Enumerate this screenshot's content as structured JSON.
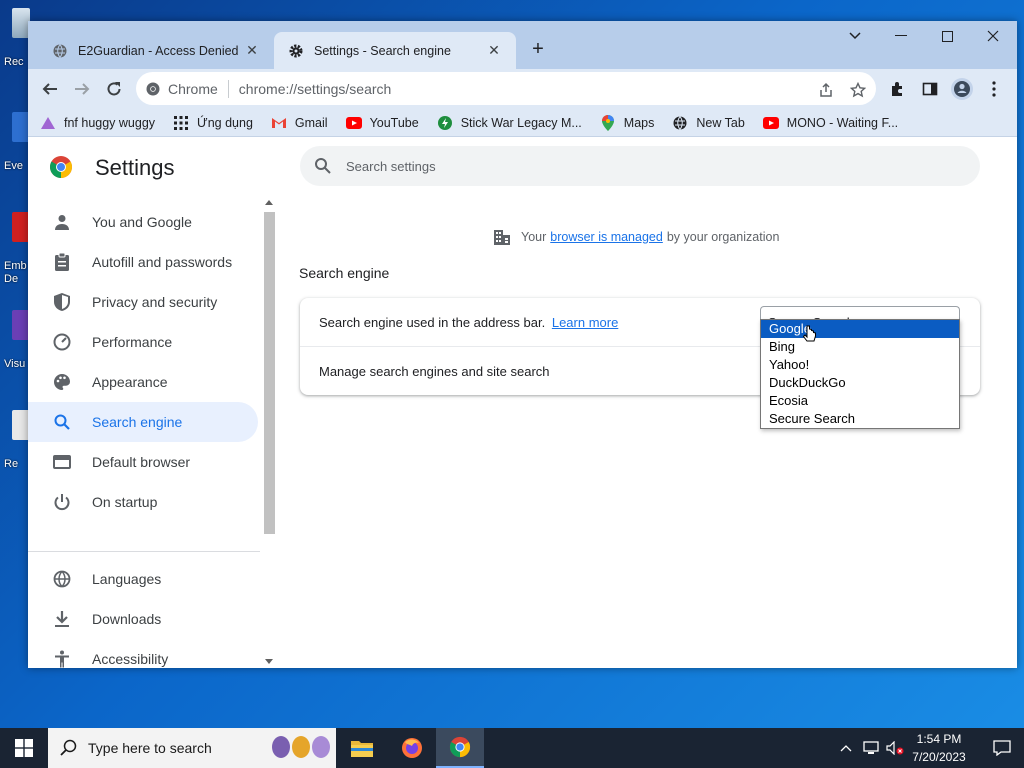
{
  "desktop": {
    "icons": [
      {
        "label": "Rec"
      },
      {
        "label": "Eve"
      },
      {
        "label": "Emb De"
      },
      {
        "label": "Visu"
      },
      {
        "label": "Re"
      }
    ]
  },
  "browser": {
    "tabs": [
      {
        "title": "E2Guardian - Access Denied",
        "active": false,
        "icon": "globe-icon"
      },
      {
        "title": "Settings - Search engine",
        "active": true,
        "icon": "gear-icon"
      }
    ],
    "omnibox": {
      "chip_label": "Chrome",
      "url": "chrome://settings/search"
    },
    "bookmarks": [
      {
        "label": "fnf huggy wuggy",
        "icon": "triangle-icon",
        "color": "#a066d3"
      },
      {
        "label": "Ứng dụng",
        "icon": "apps-grid-icon",
        "color": "#202124"
      },
      {
        "label": "Gmail",
        "icon": "gmail-icon",
        "color": "#ea4335"
      },
      {
        "label": "YouTube",
        "icon": "youtube-icon",
        "color": "#ff0000"
      },
      {
        "label": "Stick War Legacy M...",
        "icon": "game-icon",
        "color": "#1e8e3e"
      },
      {
        "label": "Maps",
        "icon": "maps-pin-icon",
        "color": "#fbbc04"
      },
      {
        "label": "New Tab",
        "icon": "globe-icon",
        "color": "#202124"
      },
      {
        "label": "MONO - Waiting F...",
        "icon": "youtube-icon",
        "color": "#ff0000"
      }
    ]
  },
  "settings": {
    "title": "Settings",
    "search_placeholder": "Search settings",
    "sidebar": [
      {
        "label": "You and Google",
        "icon": "person-icon",
        "selected": false
      },
      {
        "label": "Autofill and passwords",
        "icon": "clipboard-icon",
        "selected": false
      },
      {
        "label": "Privacy and security",
        "icon": "shield-icon",
        "selected": false
      },
      {
        "label": "Performance",
        "icon": "speedometer-icon",
        "selected": false
      },
      {
        "label": "Appearance",
        "icon": "palette-icon",
        "selected": false
      },
      {
        "label": "Search engine",
        "icon": "search-icon",
        "selected": true
      },
      {
        "label": "Default browser",
        "icon": "browser-window-icon",
        "selected": false
      },
      {
        "label": "On startup",
        "icon": "power-icon",
        "selected": false
      },
      {
        "label": "Languages",
        "icon": "globe-icon",
        "selected": false
      },
      {
        "label": "Downloads",
        "icon": "download-icon",
        "selected": false
      },
      {
        "label": "Accessibility",
        "icon": "accessibility-icon",
        "selected": false
      }
    ],
    "managed_notice": {
      "prefix": "Your",
      "link": "browser is managed",
      "suffix": "by your organization"
    },
    "section_title": "Search engine",
    "card": {
      "row1_text": "Search engine used in the address bar.",
      "row1_link": "Learn more",
      "row2_text": "Manage search engines and site search",
      "select_value": "Secure Search"
    },
    "dropdown": {
      "options": [
        "Google",
        "Bing",
        "Yahoo!",
        "DuckDuckGo",
        "Ecosia",
        "Secure Search"
      ],
      "highlighted": "Google"
    }
  },
  "taskbar": {
    "search_placeholder": "Type here to search",
    "clock_time": "1:54 PM",
    "clock_date": "7/20/2023"
  },
  "colors": {
    "accent": "#1a73e8",
    "tabstrip": "#b7cdea",
    "toolbar": "#dfe9f6",
    "dropdown_highlight": "#0b5cc2"
  }
}
